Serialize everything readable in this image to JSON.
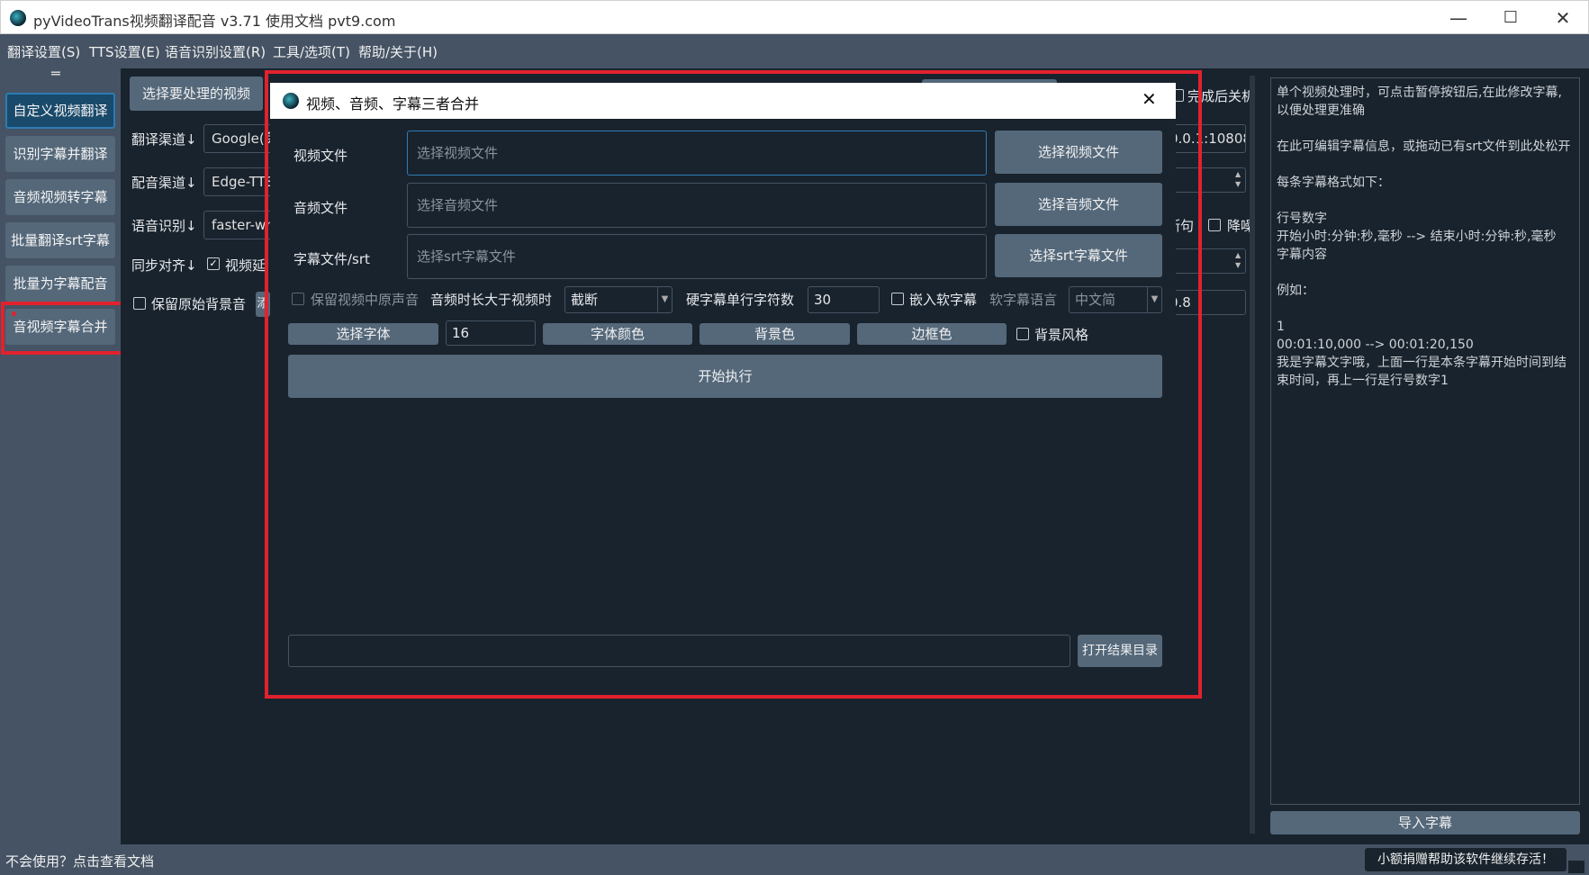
{
  "window": {
    "title": "pyVideoTrans视频翻译配音 v3.71  使用文档  pvt9.com",
    "minimize": "—",
    "maximize": "☐",
    "close": "✕"
  },
  "menu": [
    "翻译设置(S)",
    "TTS设置(E)",
    "语音识别设置(R)",
    "工具/选项(T)",
    "帮助/关于(H)"
  ],
  "sidebar": {
    "toggle": "═",
    "items": [
      "自定义视频翻译",
      "识别字幕并翻译",
      "音频视频转字幕",
      "批量翻译srt字幕",
      "批量为字幕配音",
      "音视频字幕合并"
    ]
  },
  "main": {
    "select_video": "选择要处理的视频",
    "translate_channel_label": "翻译渠道↓",
    "translate_channel_value": "Google(免",
    "dub_channel_label": "配音渠道↓",
    "dub_channel_value": "Edge-TTS(",
    "asr_label": "语音识别↓",
    "asr_value": "faster-whis",
    "sync_label": "同步对齐↓",
    "video_delay_label": "视频延",
    "keep_bg_label": "保留原始背景音",
    "add_label": "添",
    "shutdown_label": "完成后关机",
    "proxy_value": "0.0.1:10808",
    "split_label": "断句",
    "denoise_label": "降噪",
    "rate_value": "0.8"
  },
  "notes": {
    "lines": [
      "单个视频处理时，可点击暂停按钮后,在此修改字幕,以便处理更准确",
      "",
      " 在此可编辑字幕信息，或拖动已有srt文件到此处松开",
      "",
      "每条字幕格式如下：",
      "",
      "行号数字",
      "开始小时:分钟:秒,毫秒 --> 结束小时:分钟:秒,毫秒",
      "字幕内容",
      "",
      "例如：",
      "",
      "1",
      "00:01:10,000 --> 00:01:20,150",
      "我是字幕文字哦，上面一行是本条字幕开始时间到结束时间，再上一行是行号数字1"
    ],
    "import_button": "导入字幕"
  },
  "status": {
    "help_link": "不会使用？点击查看文档",
    "donate": "小额捐赠帮助该软件继续存活！"
  },
  "dialog": {
    "title": "视频、音频、字幕三者合并",
    "video_label": "视频文件",
    "video_placeholder": "选择视频文件",
    "video_button": "选择视频文件",
    "audio_label": "音频文件",
    "audio_placeholder": "选择音频文件",
    "audio_button": "选择音频文件",
    "srt_label": "字幕文件/srt",
    "srt_placeholder": "选择srt字幕文件",
    "srt_button": "选择srt字幕文件",
    "keep_original_audio": "保留视频中原声音",
    "audio_longer_label": "音频时长大于视频时",
    "audio_longer_value": "截断",
    "hard_sub_chars_label": "硬字幕单行字符数",
    "hard_sub_chars_value": "30",
    "embed_soft_sub": "嵌入软字幕",
    "soft_sub_lang_label": "软字幕语言",
    "soft_sub_lang_value": "中文简",
    "font_button": "选择字体",
    "font_size_value": "16",
    "font_color_button": "字体颜色",
    "bg_color_button": "背景色",
    "border_color_button": "边框色",
    "bg_style": "背景风格",
    "start_button": "开始执行",
    "open_result_button": "打开结果目录"
  },
  "colors": {
    "accent_red": "#e1222e",
    "panel": "#455364",
    "button": "#54687a",
    "background": "#19232d"
  }
}
